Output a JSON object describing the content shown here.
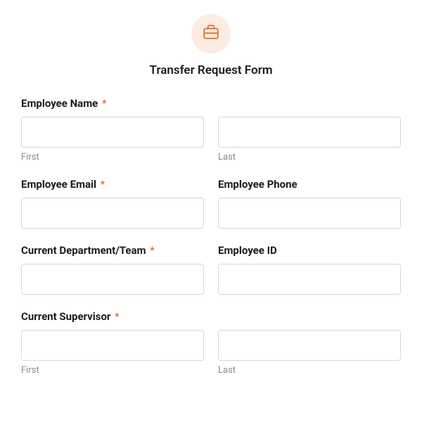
{
  "header": {
    "icon": "briefcase-icon",
    "title": "Transfer Request Form"
  },
  "fields": {
    "employeeName": {
      "label": "Employee Name",
      "required": "*",
      "first": {
        "value": "",
        "sub": "First"
      },
      "last": {
        "value": "",
        "sub": "Last"
      }
    },
    "employeeEmail": {
      "label": "Employee Email",
      "required": "*",
      "value": ""
    },
    "employeePhone": {
      "label": "Employee Phone",
      "value": ""
    },
    "currentDept": {
      "label": "Current Department/Team",
      "required": "*",
      "value": ""
    },
    "employeeId": {
      "label": "Employee ID",
      "value": ""
    },
    "currentSupervisor": {
      "label": "Current Supervisor",
      "required": "*",
      "first": {
        "value": "",
        "sub": "First"
      },
      "last": {
        "value": "",
        "sub": "Last"
      }
    }
  },
  "colors": {
    "accent": "#e06a2b",
    "iconBg": "#fdece2"
  }
}
